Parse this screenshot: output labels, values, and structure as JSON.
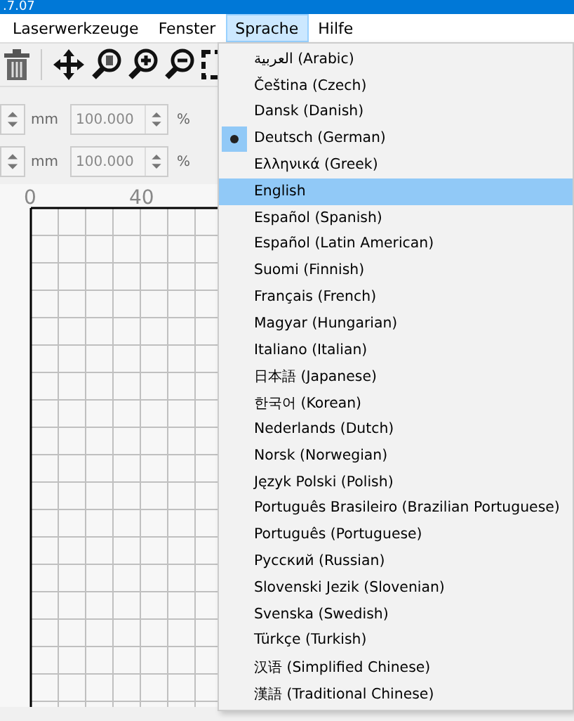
{
  "window": {
    "title": ".7.07"
  },
  "menu_bar": [
    {
      "label": "Laserwerkzeuge",
      "selected": false
    },
    {
      "label": "Fenster",
      "selected": false
    },
    {
      "label": "Sprache",
      "selected": true
    },
    {
      "label": "Hilfe",
      "selected": false
    }
  ],
  "size_rows": [
    {
      "unit": "mm",
      "scale": "100.000",
      "percent": "%"
    },
    {
      "unit": "mm",
      "scale": "100.000",
      "percent": "%"
    }
  ],
  "ruler": {
    "labels": [
      "0",
      "40"
    ]
  },
  "language_menu": [
    {
      "label": "العربية (Arabic)",
      "checked": false,
      "highlighted": false
    },
    {
      "label": "Čeština (Czech)",
      "checked": false,
      "highlighted": false
    },
    {
      "label": "Dansk (Danish)",
      "checked": false,
      "highlighted": false
    },
    {
      "label": "Deutsch (German)",
      "checked": true,
      "highlighted": false
    },
    {
      "label": "Ελληνικά (Greek)",
      "checked": false,
      "highlighted": false
    },
    {
      "label": "English",
      "checked": false,
      "highlighted": true
    },
    {
      "label": "Español (Spanish)",
      "checked": false,
      "highlighted": false
    },
    {
      "label": "Español (Latin American)",
      "checked": false,
      "highlighted": false
    },
    {
      "label": "Suomi (Finnish)",
      "checked": false,
      "highlighted": false
    },
    {
      "label": "Français (French)",
      "checked": false,
      "highlighted": false
    },
    {
      "label": "Magyar (Hungarian)",
      "checked": false,
      "highlighted": false
    },
    {
      "label": "Italiano (Italian)",
      "checked": false,
      "highlighted": false
    },
    {
      "label": "日本語 (Japanese)",
      "checked": false,
      "highlighted": false
    },
    {
      "label": "한국어 (Korean)",
      "checked": false,
      "highlighted": false
    },
    {
      "label": "Nederlands (Dutch)",
      "checked": false,
      "highlighted": false
    },
    {
      "label": "Norsk (Norwegian)",
      "checked": false,
      "highlighted": false
    },
    {
      "label": "Język Polski (Polish)",
      "checked": false,
      "highlighted": false
    },
    {
      "label": "Português Brasileiro (Brazilian Portuguese)",
      "checked": false,
      "highlighted": false
    },
    {
      "label": "Português (Portuguese)",
      "checked": false,
      "highlighted": false
    },
    {
      "label": "Русский (Russian)",
      "checked": false,
      "highlighted": false
    },
    {
      "label": "Slovenski Jezik (Slovenian)",
      "checked": false,
      "highlighted": false
    },
    {
      "label": "Svenska (Swedish)",
      "checked": false,
      "highlighted": false
    },
    {
      "label": "Türkçe (Turkish)",
      "checked": false,
      "highlighted": false
    },
    {
      "label": "汉语 (Simplified Chinese)",
      "checked": false,
      "highlighted": false
    },
    {
      "label": "漢語 (Traditional Chinese)",
      "checked": false,
      "highlighted": false
    }
  ]
}
